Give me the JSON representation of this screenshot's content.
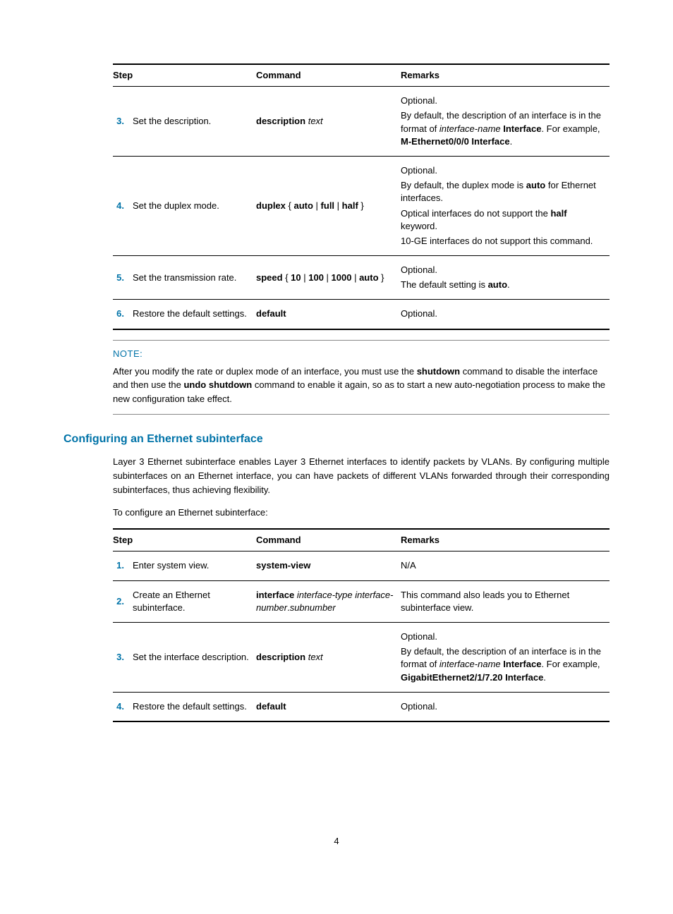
{
  "table1": {
    "headers": {
      "step": "Step",
      "command": "Command",
      "remarks": "Remarks"
    },
    "rows": {
      "r3": {
        "num": "3.",
        "step": "Set the description.",
        "cmd_b": "description",
        "cmd_i": "text",
        "rem1": "Optional.",
        "rem2a": "By default, the description of an interface is in the format of ",
        "rem2b": "interface-name",
        "rem2c": " Interface",
        "rem2d": ". For example, ",
        "rem2e": "M-Ethernet0/0/0 Interface",
        "rem2f": "."
      },
      "r4": {
        "num": "4.",
        "step": "Set the duplex mode.",
        "cmd_b1": "duplex",
        "cmd_p1": " { ",
        "cmd_b2": "auto",
        "cmd_p2": " | ",
        "cmd_b3": "full",
        "cmd_p3": " | ",
        "cmd_b4": "half",
        "cmd_p4": " }",
        "rem1": "Optional.",
        "rem2a": "By default, the duplex mode is ",
        "rem2b": "auto",
        "rem2c": " for Ethernet interfaces.",
        "rem3a": "Optical interfaces do not support the ",
        "rem3b": "half",
        "rem3c": " keyword.",
        "rem4": "10-GE interfaces do not support this command."
      },
      "r5": {
        "num": "5.",
        "step": "Set the transmission rate.",
        "cmd_b1": "speed",
        "cmd_p1": " { ",
        "cmd_b2": "10",
        "cmd_p2": " | ",
        "cmd_b3": "100",
        "cmd_p3": " | ",
        "cmd_b4": "1000",
        "cmd_p4": " | ",
        "cmd_b5": "auto",
        "cmd_p5": " }",
        "rem1": "Optional.",
        "rem2a": "The default setting is ",
        "rem2b": "auto",
        "rem2c": "."
      },
      "r6": {
        "num": "6.",
        "step": "Restore the default settings.",
        "cmd_b": "default",
        "rem1": "Optional."
      }
    }
  },
  "note": {
    "title": "NOTE:",
    "a": "After you modify the rate or duplex mode of an interface, you must use the ",
    "b": "shutdown",
    "c": " command to disable the interface and then use the ",
    "d": "undo shutdown",
    "e": " command to enable it again, so as to start a new auto-negotiation process to make the new configuration take effect."
  },
  "section_title": "Configuring an Ethernet subinterface",
  "para1": "Layer 3 Ethernet subinterface enables Layer 3 Ethernet interfaces to identify packets by VLANs. By configuring multiple subinterfaces on an Ethernet interface, you can have packets of different VLANs forwarded through their corresponding subinterfaces, thus achieving flexibility.",
  "para2": "To configure an Ethernet subinterface:",
  "table2": {
    "headers": {
      "step": "Step",
      "command": "Command",
      "remarks": "Remarks"
    },
    "rows": {
      "r1": {
        "num": "1.",
        "step": "Enter system view.",
        "cmd_b": "system-view",
        "rem1": "N/A"
      },
      "r2": {
        "num": "2.",
        "step": "Create an Ethernet subinterface.",
        "cmd_b": "interface",
        "cmd_i1": "interface-type interface-number",
        "cmd_p": ".",
        "cmd_i2": "subnumber",
        "rem1": "This command also leads you to Ethernet subinterface view."
      },
      "r3": {
        "num": "3.",
        "step": "Set the interface description.",
        "cmd_b": "description",
        "cmd_i": "text",
        "rem1": "Optional.",
        "rem2a": "By default, the description of an interface is in the format of ",
        "rem2b": "interface-name",
        "rem2c": " Interface",
        "rem2d": ". For example, ",
        "rem2e": "GigabitEthernet2/1/7.20 Interface",
        "rem2f": "."
      },
      "r4": {
        "num": "4.",
        "step": "Restore the default settings.",
        "cmd_b": "default",
        "rem1": "Optional."
      }
    }
  },
  "page_number": "4"
}
